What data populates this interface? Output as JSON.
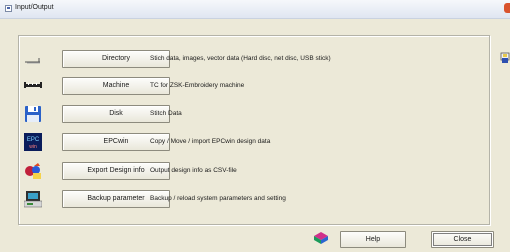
{
  "window": {
    "title": "Input/Output"
  },
  "rows": [
    {
      "label": "Directory",
      "description": "Stich data, images, vector data (Hard disc, net disc, USB stick)",
      "icon": "directory-icon"
    },
    {
      "label": "Machine",
      "description": "TC for ZSK-Embroidery machine",
      "icon": "machine-icon"
    },
    {
      "label": "Disk",
      "description": "Stitch Data",
      "icon": "floppy-disk-icon"
    },
    {
      "label": "EPCwin",
      "description": "Copy / Move / import EPCwin design data",
      "icon": "epcwin-icon",
      "icon_text_top": "EPC",
      "icon_text_bottom": "win"
    },
    {
      "label": "Export Design info",
      "description": "Output design info as CSV-file",
      "icon": "export-design-icon"
    },
    {
      "label": "Backup parameter",
      "description": "Backup / reload system parameters and setting",
      "icon": "backup-icon"
    }
  ],
  "footer": {
    "help_label": "Help",
    "close_label": "Close"
  },
  "colors": {
    "titlebar": "#dfe6f1",
    "face": "#ece9d8",
    "close_accent": "#d9532c"
  }
}
